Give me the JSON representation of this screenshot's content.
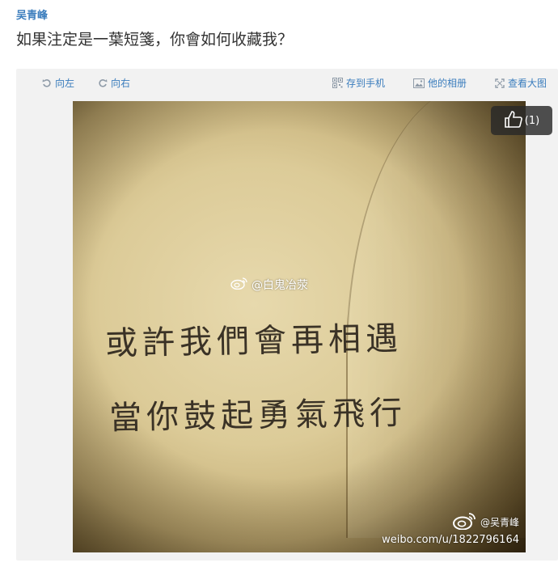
{
  "post": {
    "author": "吴青峰",
    "text": "如果注定是一葉短箋，你會如何收藏我？"
  },
  "toolbar": {
    "rotate_left_icon": "rotate-left-icon",
    "rotate_left": "向左",
    "rotate_right_icon": "rotate-right-icon",
    "rotate_right": "向右",
    "save_to_phone_icon": "qr-code-icon",
    "save_to_phone": "存到手机",
    "albums_icon": "photo-album-icon",
    "albums": "他的相册",
    "view_large_icon": "expand-icon",
    "view_large": "查看大图"
  },
  "photo": {
    "like_count": "(1)",
    "watermark_center": "@白鬼冶荥",
    "handwriting_line1": "或許我們會再相遇",
    "handwriting_line2": "當你鼓起勇氣飛行",
    "watermark_user": "@吴青峰",
    "watermark_url": "weibo.com/u/1822796164"
  },
  "colors": {
    "link": "#3b7dbd",
    "text": "#333333",
    "toolbar_bg": "#f2f2f2"
  }
}
